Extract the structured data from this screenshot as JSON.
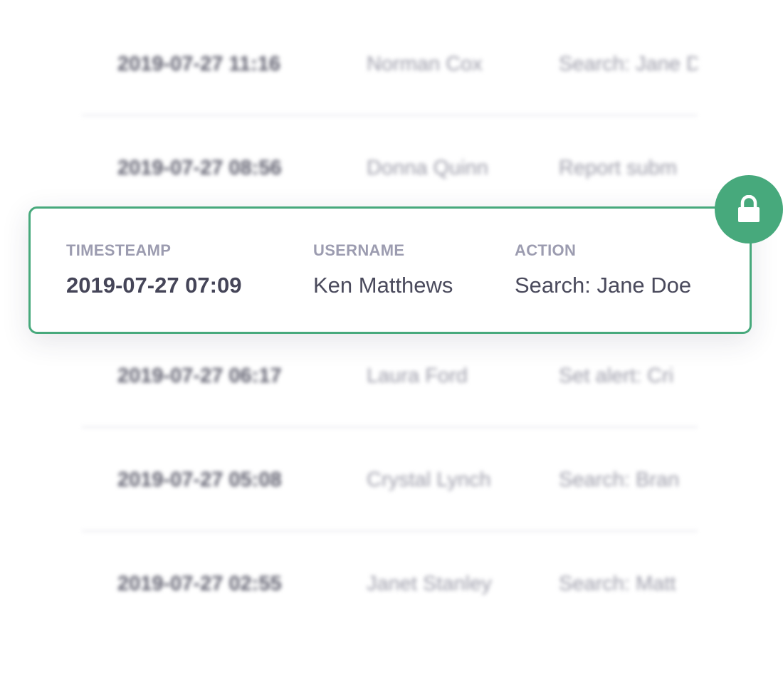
{
  "background_rows": [
    {
      "timestamp": "2019-07-27 11:16",
      "username": "Norman Cox",
      "action": "Search: Jane D"
    },
    {
      "timestamp": "2019-07-27 08:56",
      "username": "Donna Quinn",
      "action": "Report subm"
    },
    {
      "timestamp": "2019-07-27 06:17",
      "username": "Laura Ford",
      "action": "Set alert: Cri"
    },
    {
      "timestamp": "2019-07-27 05:08",
      "username": "Crystal Lynch",
      "action": "Search: Bran"
    },
    {
      "timestamp": "2019-07-27 02:55",
      "username": "Janet Stanley",
      "action": "Search: Matt"
    }
  ],
  "card": {
    "headers": {
      "timestamp": "TIMESTEAMP",
      "username": "USERNAME",
      "action": "ACTION"
    },
    "row": {
      "timestamp": "2019-07-27 07:09",
      "username": "Ken Matthews",
      "action": "Search: Jane Doe"
    }
  },
  "badge": {
    "icon": "lock-icon",
    "color": "#47a97c"
  },
  "colors": {
    "accent": "#47a97c",
    "text_dark": "#454558",
    "text_header": "#9c9cb0",
    "divider": "#e8e8ee"
  }
}
